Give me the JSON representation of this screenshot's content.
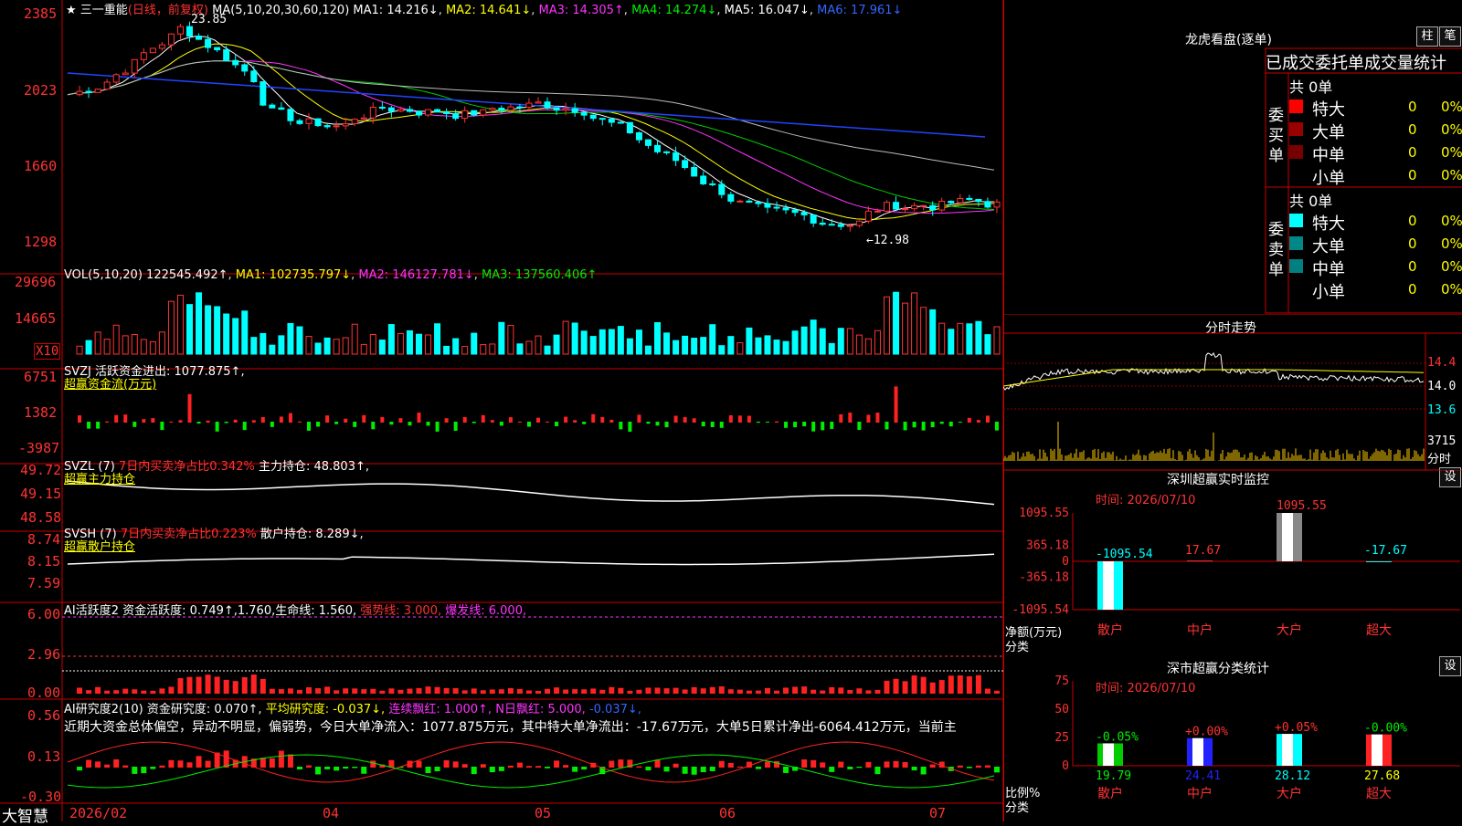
{
  "stock": {
    "name": "三一重能",
    "period": "(日线，前复权)",
    "ma_header": "MA(5,10,20,30,60,120)",
    "ma1": "MA1: 14.216↓",
    "ma2": "MA2: 14.641↓",
    "ma3": "MA3: 14.305↑",
    "ma4": "MA4: 14.274↓",
    "ma5": "MA5: 16.047↓",
    "ma6": "MA6: 17.961↓",
    "high_label": "23.85",
    "low_label": "←12.98",
    "y_labels": [
      "2385",
      "2023",
      "1660",
      "1298"
    ]
  },
  "vol": {
    "header": "VOL(5,10,20)",
    "value": "122545.492↑",
    "ma1": "MA1: 102735.797↓",
    "ma2": "MA2: 146127.781↓",
    "ma3": "MA3: 137560.406↑",
    "y_labels": [
      "29696",
      "14665"
    ],
    "unit": "X10"
  },
  "svzj": {
    "header": "SVZJ  活跃资金进出: 1077.875↑,",
    "sub": "超赢资金流(万元)",
    "y_labels": [
      "6751",
      "1382",
      "-3987"
    ]
  },
  "svzl": {
    "header": "SVZL (7)",
    "ratio": "7日内买卖净占比0.342%",
    "hold": "主力持仓: 48.803↑,",
    "sub": "超赢主力持仓",
    "y_labels": [
      "49.72",
      "49.15",
      "48.58"
    ]
  },
  "svsh": {
    "header": "SVSH (7)",
    "ratio": "7日内买卖净占比0.223%",
    "hold": "散户持仓: 8.289↓,",
    "sub": "超赢散户持仓",
    "y_labels": [
      "8.74",
      "8.15",
      "7.59"
    ]
  },
  "ai_active": {
    "header": "AI活跃度2 资金活跃度: 0.749↑,1.760,生命线: 1.560,",
    "strong": "强势线: 3.000,",
    "burst": "爆发线: 6.000,",
    "y_labels": [
      "6.00",
      "2.96",
      "0.00"
    ]
  },
  "ai_research": {
    "header": "AI研究度2(10) 资金研究度: 0.070↑,",
    "avg": "平均研究度: -0.037↓,",
    "red1": "连续飘红: 1.000↑,",
    "red2": "N日飘红: 5.000,",
    "neg": "-0.037↓,",
    "y_labels": [
      "0.56",
      "0.13",
      "-0.30"
    ],
    "comment": "近期大资金总体偏空，异动不明显，偏弱势，今日大单净流入：1077.875万元，其中特大单净流出：-17.67万元，大单5日累计净出-6064.412万元，当前主"
  },
  "xaxis": {
    "brand": "大智慧",
    "labels": [
      "2026/02",
      "04",
      "05",
      "06",
      "07"
    ]
  },
  "dragon": {
    "title": "龙虎看盘(逐单)",
    "btn1": "柱",
    "btn2": "笔",
    "table_title": "已成交委托单成交量统计",
    "buy_label": "委买单",
    "sell_label": "委卖单",
    "count": "共 0单",
    "rows": [
      "特大",
      "大单",
      "中单",
      "小单"
    ],
    "vals": [
      "0",
      "0%"
    ],
    "buy_colors": [
      "#ff0000",
      "#990000",
      "#770000",
      "#000000"
    ],
    "sell_colors": [
      "#00ffff",
      "#008888",
      "#008080",
      "#000000"
    ]
  },
  "intraday": {
    "title": "分时走势",
    "prices": [
      "14.4",
      "14.0",
      "13.6"
    ],
    "vol": "3715",
    "unit": "分时"
  },
  "sz_monitor": {
    "title": "深圳超赢实时监控",
    "btn": "设",
    "date": "时间: 2026/07/10",
    "y_labels": [
      "1095.55",
      "365.18",
      "0",
      "-365.18",
      "-1095.54"
    ],
    "bar_values": [
      "-1095.54",
      "17.67",
      "1095.55",
      "-17.67"
    ],
    "values": [
      -1095.54,
      17.67,
      1095.55,
      -17.67
    ],
    "categories": [
      "散户",
      "中户",
      "大户",
      "超大"
    ],
    "unit1": "净额(万元)",
    "unit2": "分类"
  },
  "sz_stats": {
    "title": "深市超赢分类统计",
    "btn": "设",
    "date": "时间: 2026/07/10",
    "y_labels": [
      "75",
      "50",
      "25",
      "0"
    ],
    "pct": [
      "-0.05%",
      "+0.00%",
      "+0.05%",
      "-0.00%"
    ],
    "values": [
      19.79,
      24.41,
      28.12,
      27.68
    ],
    "vals": [
      "19.79",
      "24.41",
      "28.12",
      "27.68"
    ],
    "categories": [
      "散户",
      "中户",
      "大户",
      "超大"
    ],
    "unit1": "比例%",
    "unit2": "分类"
  },
  "chart_data": [
    {
      "type": "bar",
      "title": "深圳超赢实时监控",
      "categories": [
        "散户",
        "中户",
        "大户",
        "超大"
      ],
      "values": [
        -1095.54,
        17.67,
        1095.55,
        -17.67
      ],
      "ylabel": "净额(万元)",
      "xlabel": "分类",
      "ylim": [
        -1095.54,
        1095.55
      ]
    },
    {
      "type": "bar",
      "title": "深市超赢分类统计",
      "categories": [
        "散户",
        "中户",
        "大户",
        "超大"
      ],
      "values": [
        19.79,
        24.41,
        28.12,
        27.68
      ],
      "ylabel": "比例%",
      "xlabel": "分类",
      "ylim": [
        0,
        75
      ]
    }
  ]
}
